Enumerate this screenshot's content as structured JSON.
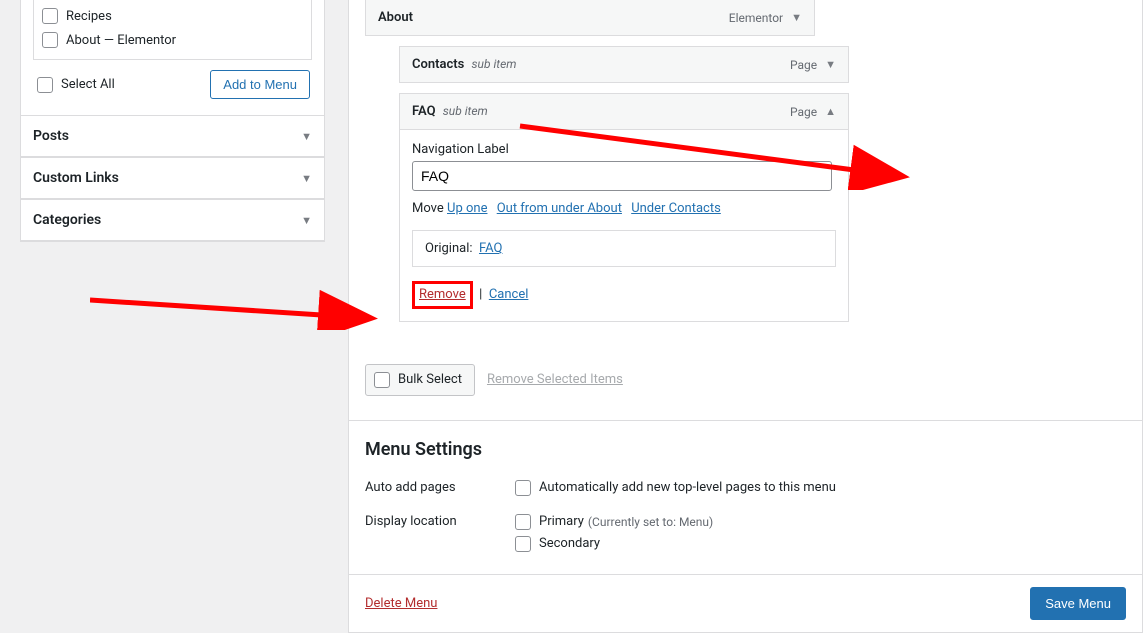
{
  "sidebar": {
    "pages": {
      "list": [
        {
          "label": "Recipes"
        },
        {
          "label": "About",
          "suffix": " — Elementor"
        }
      ],
      "select_all": "Select All",
      "add_to_menu": "Add to Menu"
    },
    "accordions": [
      {
        "label": "Posts"
      },
      {
        "label": "Custom Links"
      },
      {
        "label": "Categories"
      }
    ]
  },
  "menu_items": {
    "about": {
      "title": "About",
      "type": "Elementor"
    },
    "contacts": {
      "title": "Contacts",
      "sub": "sub item",
      "type": "Page"
    },
    "faq": {
      "title": "FAQ",
      "sub": "sub item",
      "type": "Page",
      "nav_label_label": "Navigation Label",
      "nav_label_value": "FAQ",
      "move_label": "Move",
      "move_links": {
        "up_one": "Up one",
        "out_under": "Out from under About",
        "under_contacts": "Under Contacts"
      },
      "original_label": "Original:",
      "original_link": "FAQ",
      "remove": "Remove",
      "cancel": "Cancel"
    }
  },
  "bulk": {
    "button": "Bulk Select",
    "remove": "Remove Selected Items"
  },
  "menu_settings": {
    "heading": "Menu Settings",
    "auto_add_label": "Auto add pages",
    "auto_add_opt": "Automatically add new top-level pages to this menu",
    "display_loc_label": "Display location",
    "primary": "Primary",
    "primary_hint": "(Currently set to: Menu)",
    "secondary": "Secondary"
  },
  "footer": {
    "delete": "Delete Menu",
    "save": "Save Menu"
  }
}
